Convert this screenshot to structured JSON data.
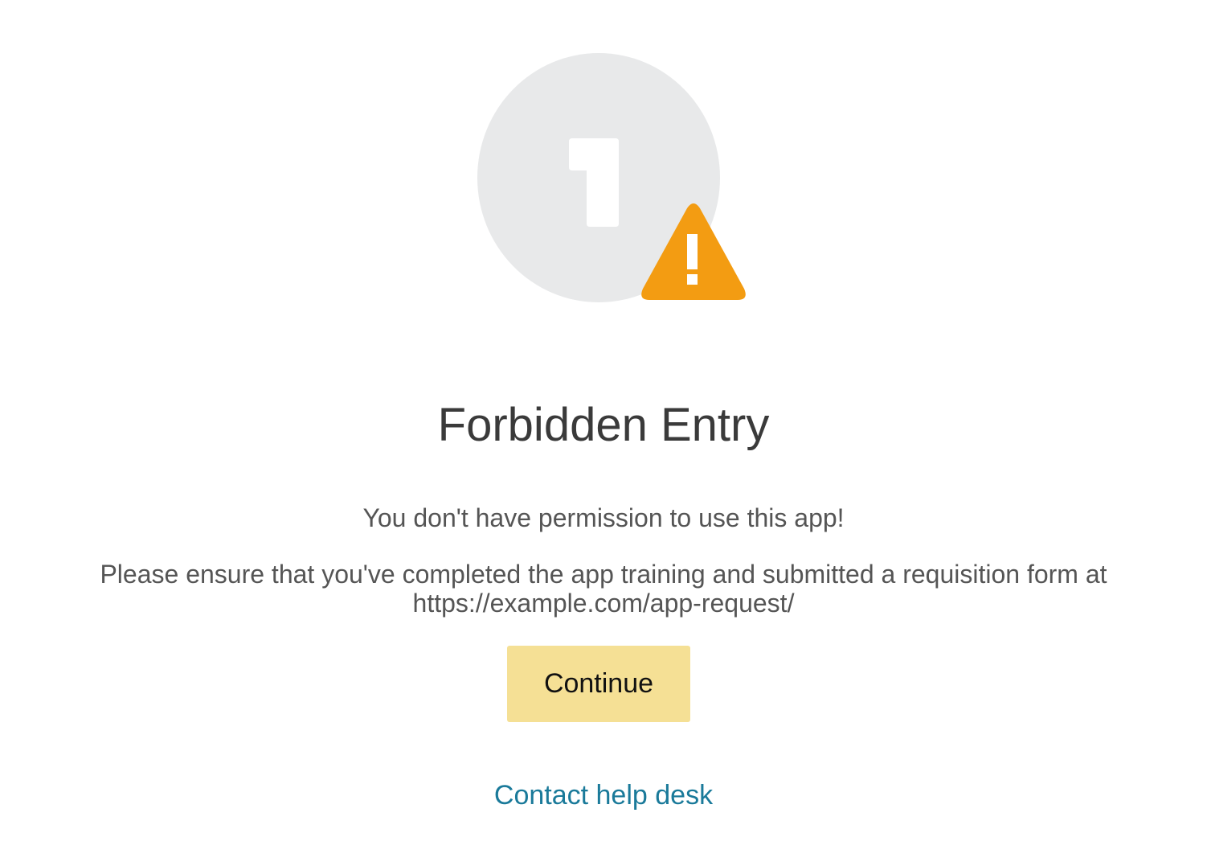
{
  "page": {
    "title": "Forbidden Entry",
    "message": "You don't have permission to use this app!",
    "instructions": "Please ensure that you've completed the app training and submitted a requisition form at https://example.com/app-request/",
    "continue_label": "Continue",
    "help_link_label": "Contact help desk"
  },
  "icons": {
    "hero": "app-badge-icon",
    "warning": "warning-triangle-icon"
  },
  "colors": {
    "hero_circle": "#e8e9ea",
    "warning": "#f39c12",
    "button_bg": "#f5e095",
    "link": "#1a7a9a",
    "title_text": "#3a3a3a",
    "body_text": "#555555"
  }
}
